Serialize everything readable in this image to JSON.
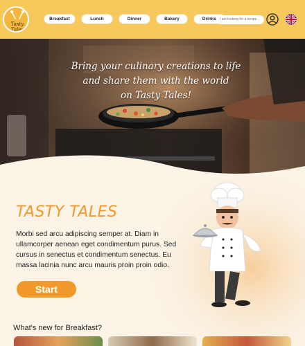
{
  "logo": {
    "text": "Tasty Tales"
  },
  "nav": {
    "items": [
      "Breakfast",
      "Lunch",
      "Dinner",
      "Bakery",
      "Drinks"
    ]
  },
  "search": {
    "placeholder": "I am looking for a recipe..."
  },
  "icons": {
    "user": "user-circle-icon",
    "language": "uk-flag-icon"
  },
  "hero": {
    "caption_line1": "Bring your culinary creations to life",
    "caption_line2": "and share them with the world",
    "caption_line3": "on Tasty Tales!"
  },
  "main": {
    "title": "TASTY TALES",
    "description": "Morbi sed arcu adipiscing semper at. Diam in ullamcorper aenean eget condimentum purus. Sed cursus in senectus et condimentum senectus. Eu massa lacinia nunc arcu mauris proin proin odio.",
    "start_label": "Start"
  },
  "whats_new": {
    "label": "What's new for Breakfast?"
  },
  "colors": {
    "header": "#f7c95c",
    "accent": "#f19a2b",
    "background": "#fbf3e6"
  }
}
